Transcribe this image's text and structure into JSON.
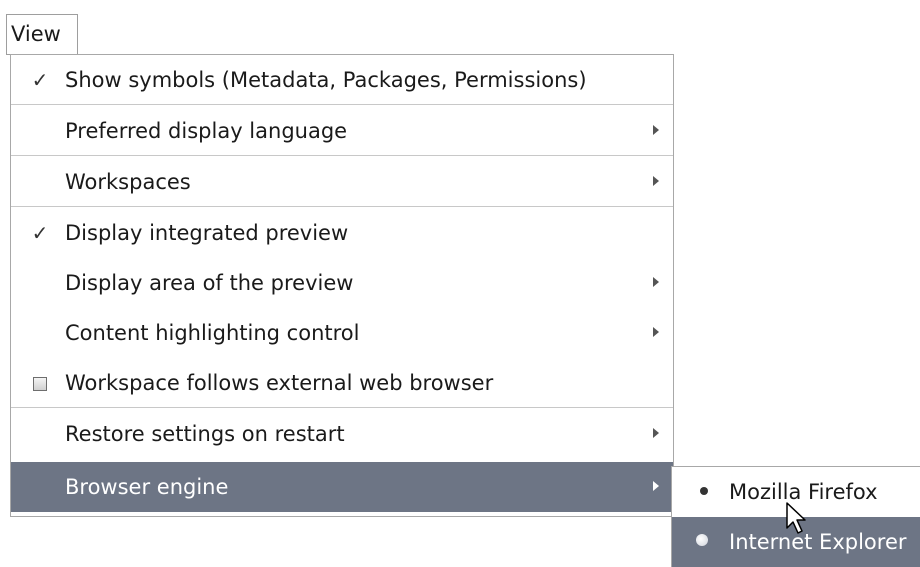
{
  "menubar": {
    "view_label": "View"
  },
  "menu": {
    "items": [
      {
        "label": "Show symbols (Metadata, Packages, Permissions)",
        "checked": true
      },
      {
        "label": "Preferred display language",
        "submenu": true
      },
      {
        "label": "Workspaces",
        "submenu": true
      },
      {
        "label": "Display integrated preview",
        "checked": true
      },
      {
        "label": "Display area of the preview",
        "submenu": true
      },
      {
        "label": "Content highlighting control",
        "submenu": true
      },
      {
        "label": "Workspace follows external web browser",
        "checkbox": true,
        "checked": false
      },
      {
        "label": "Restore settings on restart",
        "submenu": true
      },
      {
        "label": "Browser engine",
        "submenu": true,
        "active": true
      }
    ],
    "check_glyph": "✓"
  },
  "submenu": {
    "items": [
      {
        "label": "Mozilla Firefox",
        "selected": true
      },
      {
        "label": "Internet Explorer",
        "hovered": true
      }
    ]
  },
  "colors": {
    "highlight": "#6d7585",
    "border": "#a8a8a8",
    "separator": "#c8c8c8"
  }
}
